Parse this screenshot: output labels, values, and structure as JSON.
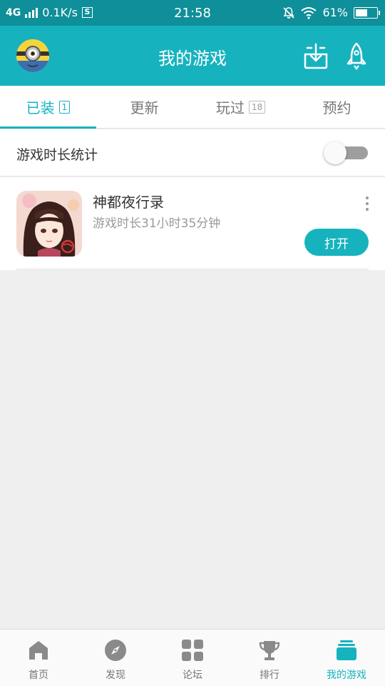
{
  "status_bar": {
    "network_type": "4G",
    "speed": "0.1K/s",
    "sim_badge": "S",
    "time": "21:58",
    "battery_percent": "61%",
    "battery_level": 0.61
  },
  "app_bar": {
    "title": "我的游戏",
    "avatar_icon": "minion-avatar-icon",
    "actions": [
      "download-manager-icon",
      "rocket-speedup-icon"
    ]
  },
  "tabs": [
    {
      "label": "已装",
      "count": "1",
      "active": true
    },
    {
      "label": "更新",
      "count": "",
      "active": false
    },
    {
      "label": "玩过",
      "count": "18",
      "active": false
    },
    {
      "label": "预约",
      "count": "",
      "active": false
    }
  ],
  "stats": {
    "label": "游戏时长统计",
    "enabled": false
  },
  "games": [
    {
      "name": "神都夜行录",
      "play_time": "游戏时长31小时35分钟",
      "action_label": "打开"
    }
  ],
  "bottom_nav": [
    {
      "label": "首页",
      "icon": "home-icon",
      "active": false
    },
    {
      "label": "发现",
      "icon": "compass-icon",
      "active": false
    },
    {
      "label": "论坛",
      "icon": "forum-grid-icon",
      "active": false
    },
    {
      "label": "排行",
      "icon": "trophy-icon",
      "active": false
    },
    {
      "label": "我的游戏",
      "icon": "my-games-icon",
      "active": true
    }
  ],
  "colors": {
    "accent": "#16b3bf",
    "status_bar": "#0f8f99",
    "background": "#efefef"
  }
}
